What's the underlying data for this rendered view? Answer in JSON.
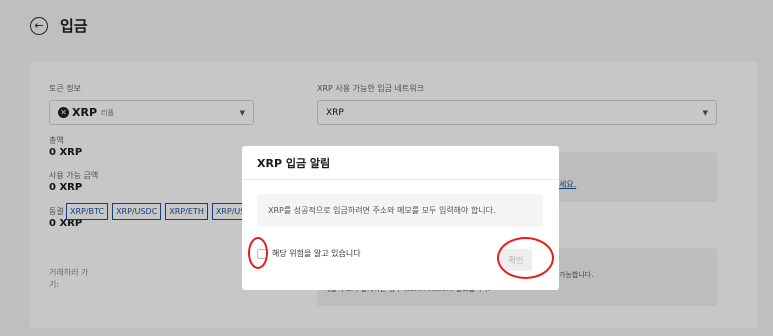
{
  "header": {
    "title": "입금"
  },
  "token_info": {
    "label": "토큰 정보",
    "token_symbol": "XRP",
    "token_name_ko": "리플",
    "total_label": "총액",
    "total_value": "0 XRP",
    "available_label": "사용 가능 금액",
    "available_value": "0 XRP",
    "locked_label": "동결 금액",
    "locked_value": "0 XRP"
  },
  "network": {
    "label": "XRP 사용 가능한 입금 네트워크",
    "selected": "XRP"
  },
  "info": {
    "link_fragment": "세요.",
    "text_fragment_1": "가능합니다.",
    "text_fragment_2": "제출 주소가 일치하는 경우 (confirmation) 필요합니다."
  },
  "trading": {
    "label": "거래하러 가기:",
    "pairs": [
      "XRP/BTC",
      "XRP/USDC",
      "XRP/ETH",
      "XRP/USDT"
    ]
  },
  "modal": {
    "title": "XRP 입금 알림",
    "message": "XRP를 성공적으로 입금하려면 주소와 메모를 모두 입력해야 합니다.",
    "checkbox_label": "해당 위험을 알고 있습니다",
    "confirm_label": "확인"
  },
  "colors": {
    "accent": "#1d4fa0",
    "annotation": "#e0201b"
  }
}
